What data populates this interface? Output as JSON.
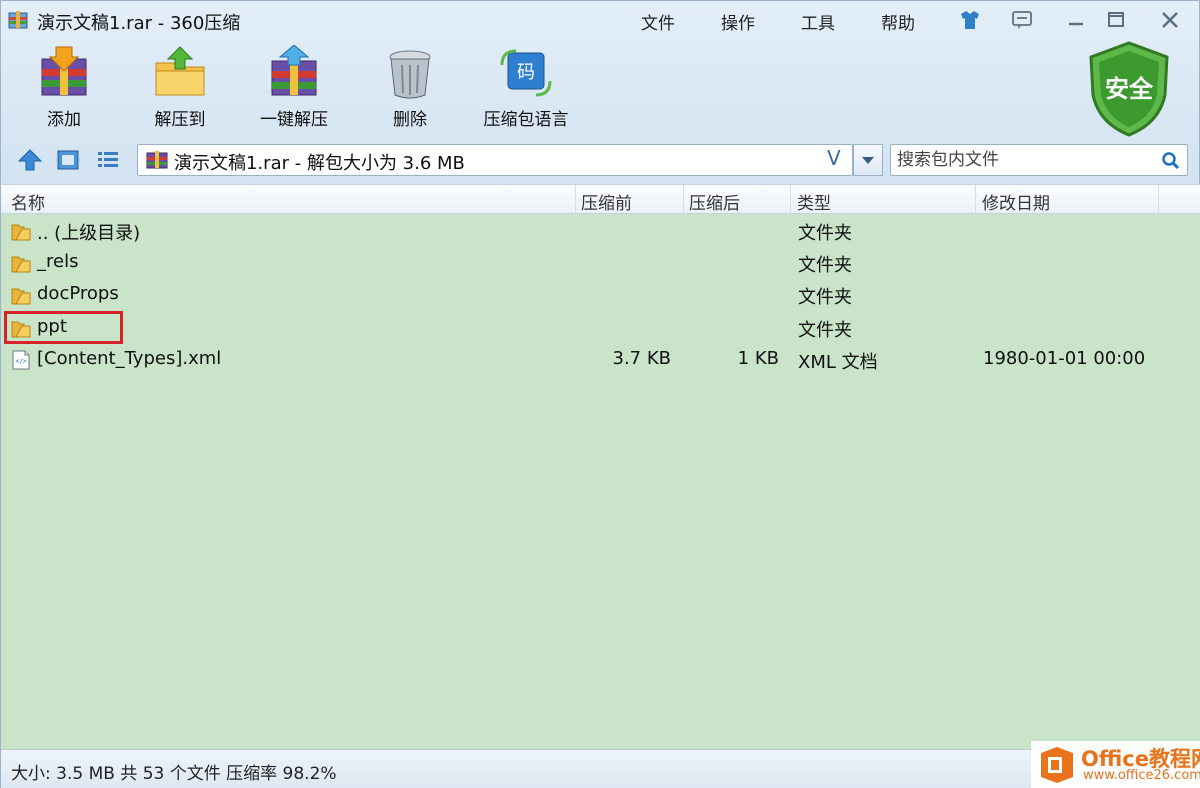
{
  "window": {
    "title": "演示文稿1.rar - 360压缩"
  },
  "menu": [
    "文件",
    "操作",
    "工具",
    "帮助"
  ],
  "toolbar": [
    {
      "label": "添加",
      "icon": "add-archive-icon"
    },
    {
      "label": "解压到",
      "icon": "extract-to-icon"
    },
    {
      "label": "一键解压",
      "icon": "one-click-extract-icon"
    },
    {
      "label": "删除",
      "icon": "delete-trash-icon"
    },
    {
      "label": "压缩包语言",
      "icon": "archive-language-icon"
    }
  ],
  "shield": {
    "label": "安全",
    "color": "#3c9a2e"
  },
  "address": {
    "path": "演示文稿1.rar - 解包大小为 3.6 MB",
    "v_glyph": "V"
  },
  "search": {
    "placeholder": "搜索包内文件"
  },
  "columns": [
    "名称",
    "压缩前",
    "压缩后",
    "类型",
    "修改日期"
  ],
  "rows": [
    {
      "name": ".. (上级目录)",
      "before": "",
      "after": "",
      "type": "文件夹",
      "date": "",
      "icon": "folder-icon"
    },
    {
      "name": "_rels",
      "before": "",
      "after": "",
      "type": "文件夹",
      "date": "",
      "icon": "folder-icon"
    },
    {
      "name": "docProps",
      "before": "",
      "after": "",
      "type": "文件夹",
      "date": "",
      "icon": "folder-icon"
    },
    {
      "name": "ppt",
      "before": "",
      "after": "",
      "type": "文件夹",
      "date": "",
      "icon": "folder-icon"
    },
    {
      "name": "[Content_Types].xml",
      "before": "3.7 KB",
      "after": "1 KB",
      "type": "XML 文档",
      "date": "1980-01-01 00:00",
      "icon": "xml-file-icon"
    }
  ],
  "status": "大小: 3.5 MB 共 53 个文件 压缩率 98.2%",
  "watermark": {
    "brand": "Office教程网",
    "url": "www.office26.com"
  },
  "colors": {
    "list_bg": "#c9e4c9",
    "highlight": "#d9232a",
    "accent": "#3a6aa0"
  }
}
